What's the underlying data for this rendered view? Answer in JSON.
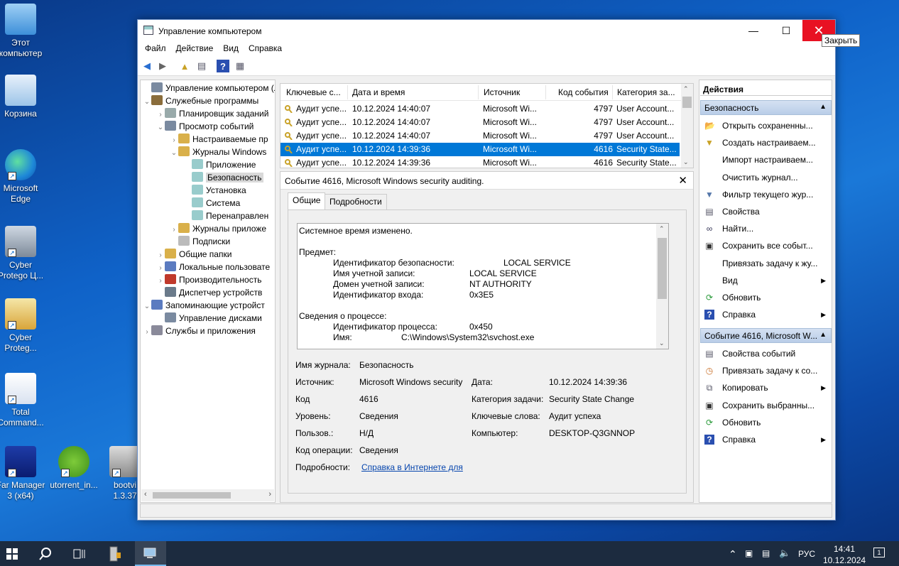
{
  "desktop": {
    "icons": [
      {
        "label": "Этот\nкомпьютер",
        "icon": "monitor-icon"
      },
      {
        "label": "Корзина",
        "icon": "recycle-bin-icon"
      },
      {
        "label": "Microsoft\nEdge",
        "icon": "edge-icon"
      },
      {
        "label": "Cyber\nProtego Ц...",
        "icon": "laptop-icon"
      },
      {
        "label": "Cyber\nProteg...",
        "icon": "user-cert-icon"
      },
      {
        "label": "Total\nCommand...",
        "icon": "floppy-icon"
      },
      {
        "label": "Far Manager\n3 (x64)",
        "icon": "far-icon"
      },
      {
        "label": "utorrent_in...",
        "icon": "utorrent-icon"
      },
      {
        "label": "bootvi\n1.3.37",
        "icon": "installer-icon"
      }
    ]
  },
  "window": {
    "title": "Управление компьютером",
    "close_tooltip": "Закрыть",
    "menu": [
      "Файл",
      "Действие",
      "Вид",
      "Справка"
    ]
  },
  "tree": {
    "items": [
      {
        "label": "Управление компьютером (л",
        "chev": ""
      },
      {
        "label": "Служебные программы",
        "chev": "⌄"
      },
      {
        "label": "Планировщик заданий",
        "chev": "›"
      },
      {
        "label": "Просмотр событий",
        "chev": "⌄"
      },
      {
        "label": "Настраиваемые пр",
        "chev": "›"
      },
      {
        "label": "Журналы Windows",
        "chev": "⌄"
      },
      {
        "label": "Приложение",
        "chev": ""
      },
      {
        "label": "Безопасность",
        "chev": ""
      },
      {
        "label": "Установка",
        "chev": ""
      },
      {
        "label": "Система",
        "chev": ""
      },
      {
        "label": "Перенаправлен",
        "chev": ""
      },
      {
        "label": "Журналы приложе",
        "chev": "›"
      },
      {
        "label": "Подписки",
        "chev": ""
      },
      {
        "label": "Общие папки",
        "chev": "›"
      },
      {
        "label": "Локальные пользовате",
        "chev": "›"
      },
      {
        "label": "Производительность",
        "chev": "›"
      },
      {
        "label": "Диспетчер устройств",
        "chev": ""
      },
      {
        "label": "Запоминающие устройст",
        "chev": "⌄"
      },
      {
        "label": "Управление дисками",
        "chev": ""
      },
      {
        "label": "Службы и приложения",
        "chev": "›"
      }
    ]
  },
  "events": {
    "columns": [
      "Ключевые с...",
      "Дата и время",
      "Источник",
      "Код события",
      "Категория за..."
    ],
    "rows": [
      {
        "keywords": "Аудит успе...",
        "datetime": "10.12.2024 14:40:07",
        "source": "Microsoft Wi...",
        "code": "4797",
        "category": "User Account..."
      },
      {
        "keywords": "Аудит успе...",
        "datetime": "10.12.2024 14:40:07",
        "source": "Microsoft Wi...",
        "code": "4797",
        "category": "User Account..."
      },
      {
        "keywords": "Аудит успе...",
        "datetime": "10.12.2024 14:40:07",
        "source": "Microsoft Wi...",
        "code": "4797",
        "category": "User Account..."
      },
      {
        "keywords": "Аудит успе...",
        "datetime": "10.12.2024 14:39:36",
        "source": "Microsoft Wi...",
        "code": "4616",
        "category": "Security State..."
      },
      {
        "keywords": "Аудит успе...",
        "datetime": "10.12.2024 14:39:36",
        "source": "Microsoft Wi...",
        "code": "4616",
        "category": "Security State..."
      }
    ]
  },
  "detail": {
    "title": "Событие 4616, Microsoft Windows security auditing.",
    "tabs": [
      "Общие",
      "Подробности"
    ],
    "description": [
      {
        "text": "Системное время изменено.",
        "indent": 0
      },
      {
        "text": "",
        "indent": 0
      },
      {
        "text": "Предмет:",
        "indent": 0
      },
      {
        "text": "Идентификатор безопасности:",
        "value": "LOCAL SERVICE",
        "valuecol": 2
      },
      {
        "text": "Имя учетной записи:",
        "value": "LOCAL SERVICE",
        "valuecol": 1
      },
      {
        "text": "Домен учетной записи:",
        "value": "NT AUTHORITY",
        "valuecol": 1
      },
      {
        "text": "Идентификатор входа:",
        "value": "0x3E5",
        "valuecol": 1
      },
      {
        "text": "",
        "indent": 0
      },
      {
        "text": "Сведения о процессе:",
        "indent": 0
      },
      {
        "text": "Идентификатор процесса:",
        "value": "0x450",
        "valuecol": 1
      },
      {
        "text": "Имя:",
        "value": "C:\\Windows\\System32\\svchost.exe",
        "valuecol": 0
      }
    ],
    "fields": {
      "log_name_label": "Имя журнала:",
      "log_name": "Безопасность",
      "source_label": "Источник:",
      "source": "Microsoft Windows security",
      "date_label": "Дата:",
      "date": "10.12.2024 14:39:36",
      "code_label": "Код",
      "code": "4616",
      "category_label": "Категория задачи:",
      "category": "Security State Change",
      "level_label": "Уровень:",
      "level": "Сведения",
      "keywords_label": "Ключевые слова:",
      "keywords": "Аудит успеха",
      "user_label": "Пользов.:",
      "user": "Н/Д",
      "computer_label": "Компьютер:",
      "computer": "DESKTOP-Q3GNNOP",
      "opcode_label": "Код операции:",
      "opcode": "Сведения",
      "more_label": "Подробности:",
      "more_link": "Справка в Интернете для"
    }
  },
  "actions": {
    "header": "Действия",
    "group1": "Безопасность",
    "items1": [
      {
        "label": "Открыть сохраненны...",
        "icon": "folder-open-icon",
        "sub": false
      },
      {
        "label": "Создать настраиваем...",
        "icon": "filter-new-icon",
        "sub": false
      },
      {
        "label": "Импорт настраиваем...",
        "icon": "",
        "sub": false
      },
      {
        "label": "Очистить журнал...",
        "icon": "",
        "sub": false
      },
      {
        "label": "Фильтр текущего жур...",
        "icon": "filter-icon",
        "sub": false
      },
      {
        "label": "Свойства",
        "icon": "properties-icon",
        "sub": false
      },
      {
        "label": "Найти...",
        "icon": "binoculars-icon",
        "sub": false
      },
      {
        "label": "Сохранить все событ...",
        "icon": "save-icon",
        "sub": false
      },
      {
        "label": "Привязать задачу к жу...",
        "icon": "",
        "sub": false
      },
      {
        "label": "Вид",
        "icon": "",
        "sub": true
      },
      {
        "label": "Обновить",
        "icon": "refresh-icon",
        "sub": false
      },
      {
        "label": "Справка",
        "icon": "help-icon",
        "sub": true
      }
    ],
    "group2": "Событие 4616, Microsoft W...",
    "items2": [
      {
        "label": "Свойства событий",
        "icon": "properties-icon",
        "sub": false
      },
      {
        "label": "Привязать задачу к со...",
        "icon": "task-icon",
        "sub": false
      },
      {
        "label": "Копировать",
        "icon": "copy-icon",
        "sub": true
      },
      {
        "label": "Сохранить выбранны...",
        "icon": "save-icon",
        "sub": false
      },
      {
        "label": "Обновить",
        "icon": "refresh-icon",
        "sub": false
      },
      {
        "label": "Справка",
        "icon": "help-icon",
        "sub": true
      }
    ]
  },
  "taskbar": {
    "lang": "РУС",
    "time": "14:41",
    "date": "10.12.2024",
    "notif_count": "1"
  }
}
